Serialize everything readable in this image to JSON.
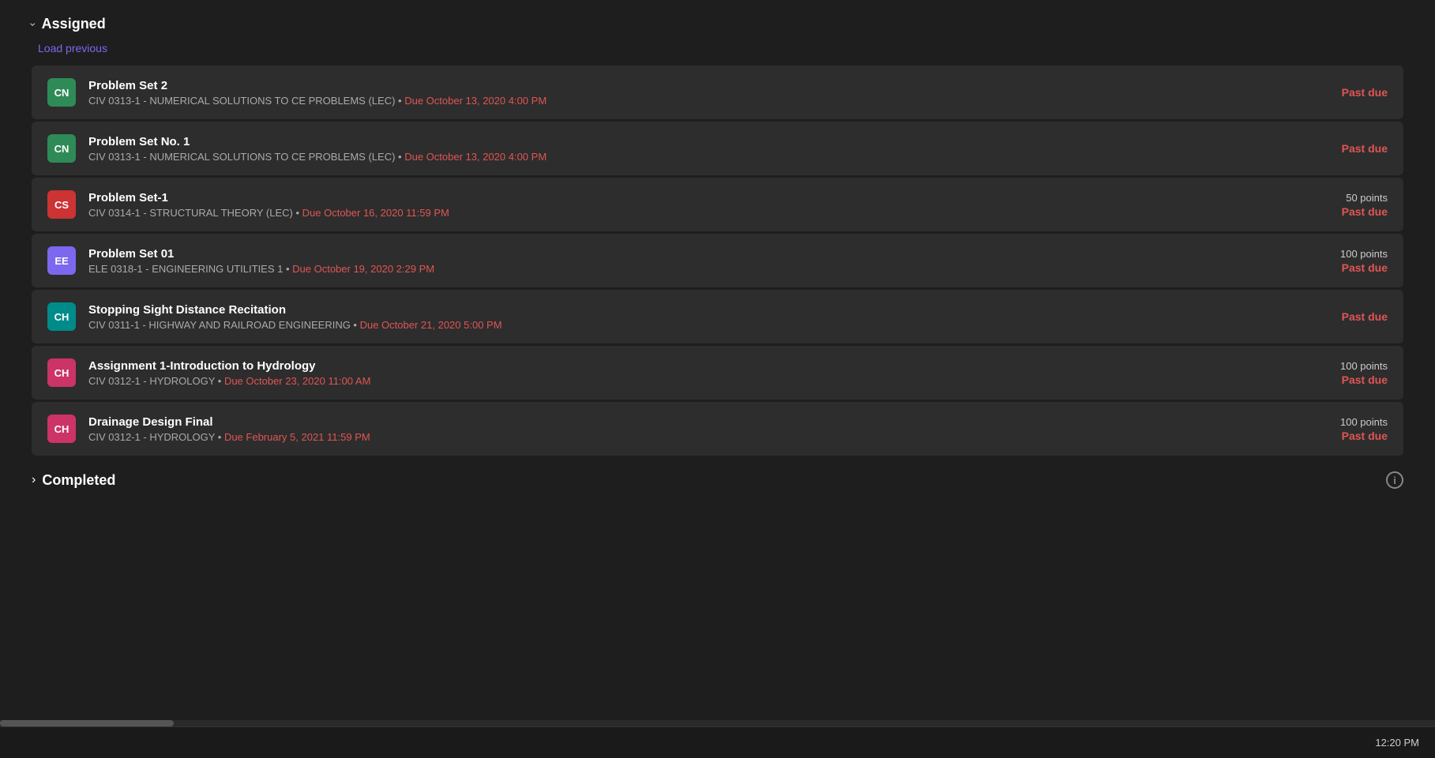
{
  "sections": {
    "assigned": {
      "label": "Assigned",
      "load_previous": "Load previous",
      "assignments": [
        {
          "id": "ps2",
          "avatar_text": "CN",
          "avatar_color": "#2e8b57",
          "title": "Problem Set 2",
          "course": "CIV 0313-1 - NUMERICAL SOLUTIONS TO CE PROBLEMS (LEC)",
          "due_prefix": "Due",
          "due_date": "October 13, 2020 4:00 PM",
          "points": null,
          "status": "Past due"
        },
        {
          "id": "psno1",
          "avatar_text": "CN",
          "avatar_color": "#2e8b57",
          "title": "Problem Set No. 1",
          "course": "CIV 0313-1 - NUMERICAL SOLUTIONS TO CE PROBLEMS (LEC)",
          "due_prefix": "Due",
          "due_date": "October 13, 2020 4:00 PM",
          "points": null,
          "status": "Past due"
        },
        {
          "id": "ps1",
          "avatar_text": "CS",
          "avatar_color": "#cc3333",
          "title": "Problem Set-1",
          "course": "CIV 0314-1 - STRUCTURAL THEORY (LEC)",
          "due_prefix": "Due",
          "due_date": "October 16, 2020 11:59 PM",
          "points": "50 points",
          "status": "Past due"
        },
        {
          "id": "ps01",
          "avatar_text": "EE",
          "avatar_color": "#7b68ee",
          "title": "Problem Set 01",
          "course": "ELE 0318-1 - ENGINEERING UTILITIES 1",
          "due_prefix": "Due",
          "due_date": "October 19, 2020 2:29 PM",
          "points": "100 points",
          "status": "Past due"
        },
        {
          "id": "ssd",
          "avatar_text": "CH",
          "avatar_color": "#008b8b",
          "title": "Stopping Sight Distance Recitation",
          "course": "CIV 0311-1 - HIGHWAY AND RAILROAD ENGINEERING",
          "due_prefix": "Due",
          "due_date": "October 21, 2020 5:00 PM",
          "points": null,
          "status": "Past due"
        },
        {
          "id": "hydro1",
          "avatar_text": "CH",
          "avatar_color": "#cc3366",
          "title": "Assignment 1-Introduction to Hydrology",
          "course": "CIV 0312-1 - HYDROLOGY",
          "due_prefix": "Due",
          "due_date": "October 23, 2020 11:00 AM",
          "points": "100 points",
          "status": "Past due"
        },
        {
          "id": "ddf",
          "avatar_text": "CH",
          "avatar_color": "#cc3366",
          "title": "Drainage Design Final",
          "course": "CIV 0312-1 - HYDROLOGY",
          "due_prefix": "Due",
          "due_date": "February 5, 2021 11:59 PM",
          "points": "100 points",
          "status": "Past due"
        }
      ]
    },
    "completed": {
      "label": "Completed"
    }
  },
  "taskbar": {
    "time": "12:20 PM"
  },
  "icons": {
    "chevron_down": "›",
    "chevron_right": "›",
    "info": "i"
  }
}
